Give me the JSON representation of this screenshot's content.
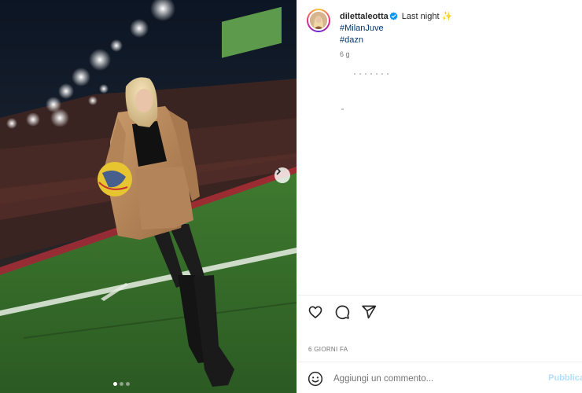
{
  "post": {
    "username": "dilettaleotta",
    "caption": "Last night",
    "caption_emoji": "✨",
    "hashtags": [
      "#MilanJuve",
      "#dazn"
    ],
    "age": "6 g",
    "date": "6 GIORNI FA"
  },
  "comment": {
    "placeholder": "Aggiungi un commento...",
    "publish_label": "Pubblica"
  },
  "icons": {
    "like": "heart-icon",
    "comment": "comment-bubble-icon",
    "share": "paper-plane-icon",
    "emoji": "smiley-icon",
    "verified": "verified-badge-icon",
    "next": "chevron-right-icon"
  },
  "carousel": {
    "count": 3,
    "active": 1
  },
  "colors": {
    "verified": "#0095f6",
    "hashtag": "#00376b",
    "publish": "#b2dffc"
  }
}
